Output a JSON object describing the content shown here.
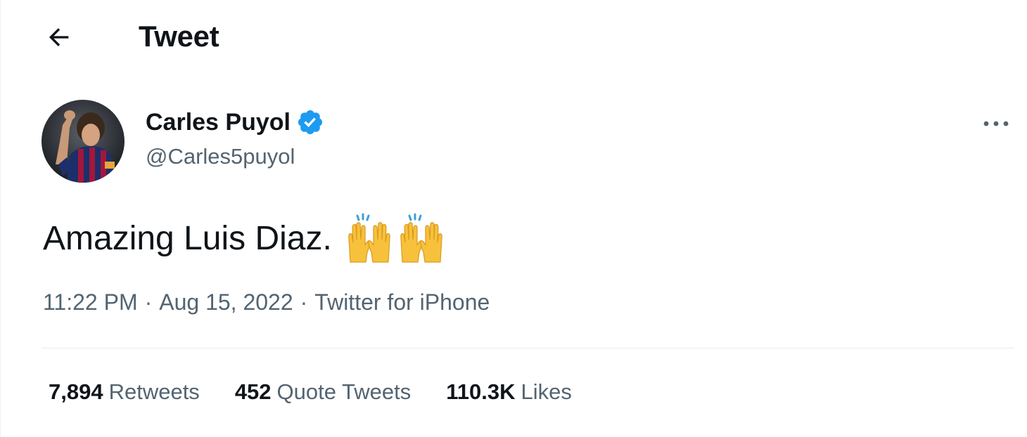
{
  "header": {
    "back_icon": "arrow-left-icon",
    "title": "Tweet"
  },
  "tweet": {
    "author": {
      "display_name": "Carles Puyol",
      "handle": "@Carles5puyol",
      "verified": true,
      "verified_badge_color": "#1d9bf0"
    },
    "more_icon": "more-horizontal-icon",
    "text": "Amazing Luis Diaz.",
    "emoji": "raising-hands-emoji",
    "emoji_count": 2,
    "time": "11:22 PM",
    "separator": "·",
    "date": "Aug 15, 2022",
    "source": "Twitter for iPhone"
  },
  "stats": {
    "retweets_count": "7,894",
    "retweets_label": "Retweets",
    "quotes_count": "452",
    "quotes_label": "Quote Tweets",
    "likes_count": "110.3K",
    "likes_label": "Likes"
  },
  "colors": {
    "text_primary": "#0f1419",
    "text_secondary": "#536471",
    "accent": "#1d9bf0",
    "divider": "#eff3f4"
  }
}
